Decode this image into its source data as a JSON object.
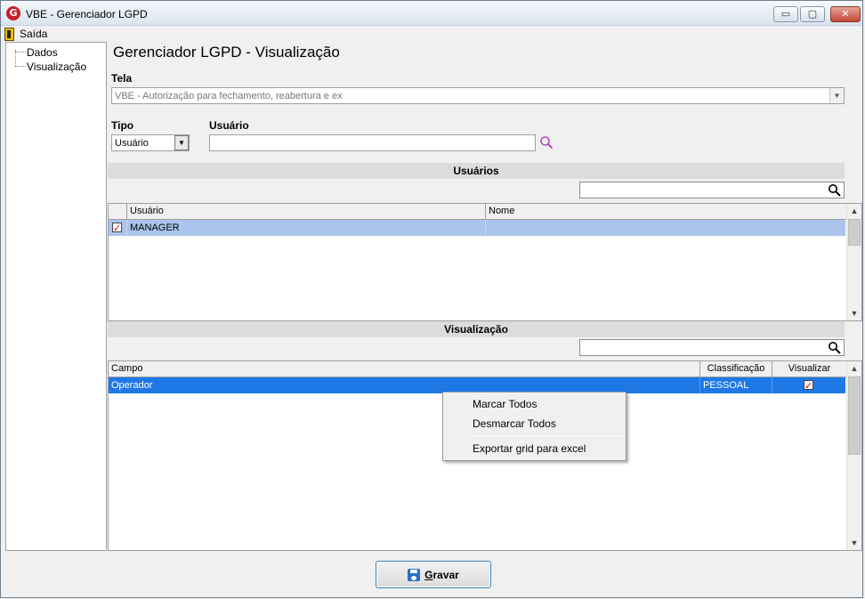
{
  "window": {
    "title": "VBE - Gerenciador LGPD",
    "logo_letter": "G",
    "buttons": {
      "minimize": "▭",
      "maximize": "▢",
      "close": "✕"
    }
  },
  "menu": {
    "exit_label": "Saída"
  },
  "tree": {
    "items": [
      "Dados",
      "Visualização"
    ]
  },
  "header": {
    "title": "Gerenciador LGPD - Visualização"
  },
  "form": {
    "tela_label": "Tela",
    "tela_value": "VBE - Autorização para fechamento, reabertura e ex",
    "tipo_label": "Tipo",
    "tipo_value": "Usuário",
    "usuario_label": "Usuário",
    "usuario_value": ""
  },
  "usuarios": {
    "section_title": "Usuários",
    "search_value": "",
    "columns": [
      "Usuário",
      "Nome"
    ],
    "rows": [
      {
        "checked": true,
        "usuario": "MANAGER",
        "nome": ""
      }
    ]
  },
  "visualizacao": {
    "section_title": "Visualização",
    "search_value": "",
    "columns": [
      "Campo",
      "Classificação",
      "Visualizar"
    ],
    "rows": [
      {
        "campo": "Operador",
        "classificacao": "PESSOAL",
        "visualizar": true
      }
    ]
  },
  "context_menu": {
    "items": [
      "Marcar Todos",
      "Desmarcar Todos",
      "Exportar grid para excel"
    ]
  },
  "footer": {
    "save_label": "Gravar",
    "save_mnemonic": "G",
    "save_rest": "ravar"
  },
  "colors": {
    "selected_row": "#1e78e6",
    "user_row": "#aac4ec",
    "search_accent": "#b04ab8",
    "checkbox_mark": "#dd0000"
  }
}
